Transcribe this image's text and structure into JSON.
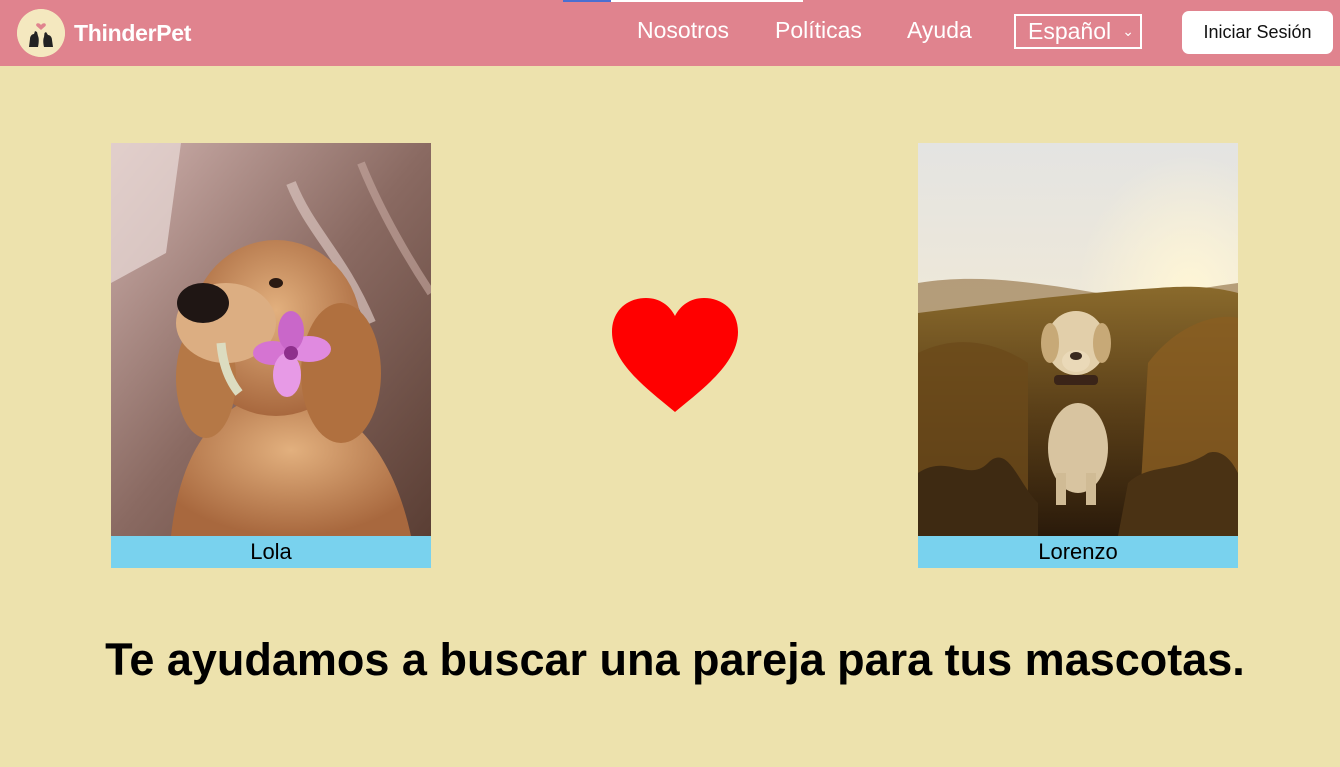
{
  "header": {
    "brand": "ThinderPet",
    "logo_icon": "dogs-heart-logo-icon",
    "nav": [
      {
        "label": "Nosotros"
      },
      {
        "label": "Políticas"
      },
      {
        "label": "Ayuda"
      }
    ],
    "language": {
      "selected": "Español",
      "icon": "chevron-down-icon"
    },
    "login_label": "Iniciar Sesión"
  },
  "pets": [
    {
      "name": "Lola",
      "photo": "golden-retriever-with-flower"
    },
    {
      "name": "Lorenzo",
      "photo": "labrador-in-sunset-field"
    }
  ],
  "match_icon": "heart-icon",
  "tagline": "Te ayudamos a buscar una pareja para tus mascotas.",
  "colors": {
    "navbar": "#e0838e",
    "background": "#ede2ad",
    "name_bar": "#79d2ee",
    "heart": "#ff0000"
  }
}
